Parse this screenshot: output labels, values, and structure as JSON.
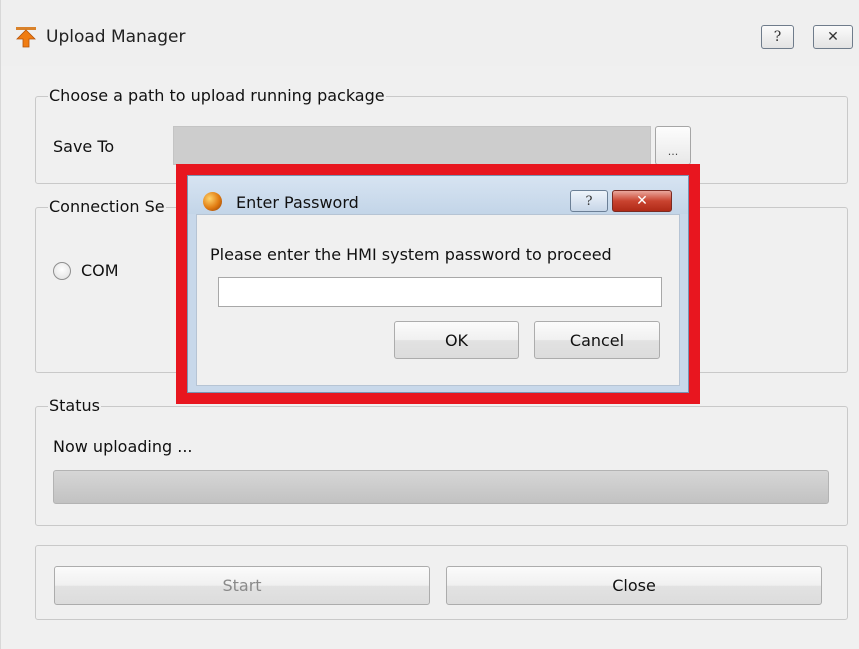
{
  "window": {
    "title": "Upload Manager",
    "help_label": "?",
    "close_label": "✕",
    "icon": "upload-arrow-icon"
  },
  "path_group": {
    "title": "Choose a path to upload running package",
    "save_to_label": "Save To",
    "save_to_value": "",
    "browse_label": "..."
  },
  "connection_group": {
    "title": "Connection Se",
    "com_label": "COM",
    "com_selected": false
  },
  "status_group": {
    "title": "Status",
    "status_text": "Now uploading ...",
    "progress": 0
  },
  "actions": {
    "start_label": "Start",
    "start_enabled": false,
    "close_label": "Close"
  },
  "password_dialog": {
    "title": "Enter Password",
    "help_label": "?",
    "close_label": "✕",
    "prompt": "Please enter the HMI system password to proceed",
    "password_value": "",
    "ok_label": "OK",
    "cancel_label": "Cancel",
    "highlight_color": "#e8161f"
  }
}
